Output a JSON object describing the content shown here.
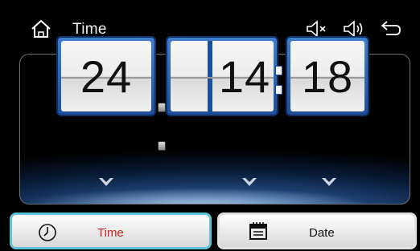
{
  "header": {
    "title": "Time",
    "icons": {
      "home": "home-icon",
      "mute": "volume-mute-icon",
      "volume": "volume-up-icon",
      "back": "back-icon"
    }
  },
  "clock": {
    "format": "24",
    "hours": "14",
    "minutes": "18"
  },
  "tabs": [
    {
      "label": "Time",
      "icon": "clock-icon",
      "active": true
    },
    {
      "label": "Date",
      "icon": "calendar-icon",
      "active": false
    }
  ],
  "colors": {
    "active_tab_border": "#5fc3d6",
    "active_tab_label": "#d0211c",
    "card_frame": "#2a62b0"
  }
}
